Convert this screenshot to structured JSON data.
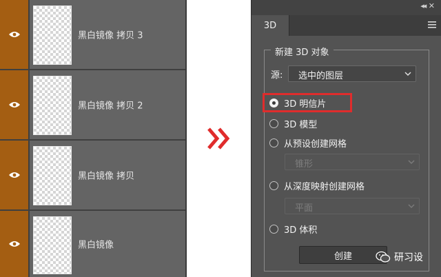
{
  "layers_panel": {
    "layers": [
      {
        "name": "黑白镜像 拷贝 3",
        "visible": true
      },
      {
        "name": "黑白镜像 拷贝 2",
        "visible": true
      },
      {
        "name": "黑白镜像 拷贝",
        "visible": true
      },
      {
        "name": "黑白镜像",
        "visible": true
      }
    ]
  },
  "panel": {
    "tab_label": "3D",
    "group_title": "新建 3D 对象",
    "source_label": "源:",
    "source_value": "选中的图层",
    "options": [
      {
        "label": "3D 明信片",
        "checked": true
      },
      {
        "label": "3D 模型",
        "checked": false
      },
      {
        "label": "从预设创建网格",
        "checked": false
      },
      {
        "label": "从深度映射创建网格",
        "checked": false
      },
      {
        "label": "3D 体积",
        "checked": false
      }
    ],
    "preset_select_value": "锥形",
    "depth_select_value": "平面",
    "create_button_label": "创建"
  },
  "watermark": {
    "text": "研习设"
  },
  "colors": {
    "highlight": "#e02c2c",
    "eye_column": "#a45e12",
    "arrow": "#e02c2c"
  }
}
